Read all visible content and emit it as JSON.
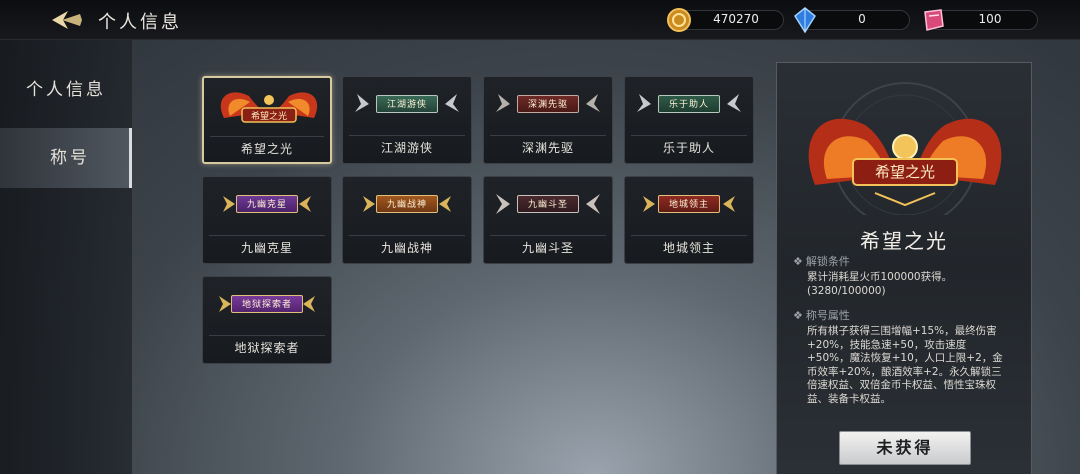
{
  "header": {
    "title": "个人信息",
    "currencies": [
      {
        "icon": "gold-coin-icon",
        "value": "470270"
      },
      {
        "icon": "blue-crystal-icon",
        "value": "0"
      },
      {
        "icon": "pink-gem-icon",
        "value": "100"
      }
    ]
  },
  "sidebar": {
    "tabs": [
      {
        "label": "个人信息"
      },
      {
        "label": "称号"
      }
    ]
  },
  "titles": [
    {
      "name": "希望之光",
      "badge": "希望之光",
      "selected": true
    },
    {
      "name": "江湖游侠",
      "badge": "江湖游侠"
    },
    {
      "name": "深渊先驱",
      "badge": "深渊先驱"
    },
    {
      "name": "乐于助人",
      "badge": "乐于助人"
    },
    {
      "name": "九幽克星",
      "badge": "九幽克星"
    },
    {
      "name": "九幽战神",
      "badge": "九幽战神"
    },
    {
      "name": "九幽斗圣",
      "badge": "九幽斗圣"
    },
    {
      "name": "地城领主",
      "badge": "地城领主"
    },
    {
      "name": "地狱探索者",
      "badge": "地狱探索者"
    }
  ],
  "detail": {
    "emblem_text": "希望之光",
    "title": "希望之光",
    "unlock_label": "解锁条件",
    "unlock_text": "累计消耗星火币100000获得。(3280/100000)",
    "attr_label": "称号属性",
    "attr_text": "所有棋子获得三围增幅+15%，最终伤害+20%，技能急速+50，攻击速度+50%，魔法恢复+10，人口上限+2，金币效率+20%，酿酒效率+2。永久解锁三倍速权益、双倍金币卡权益、悟性宝珠权益、装备卡权益。",
    "button_label": "未获得"
  },
  "colors": {
    "accent_gold": "#d8caa0",
    "badge_green": "#2f5a48",
    "badge_red": "#7a2a22",
    "badge_purple": "#5a2d7a",
    "badge_orange": "#8a4a1a"
  }
}
